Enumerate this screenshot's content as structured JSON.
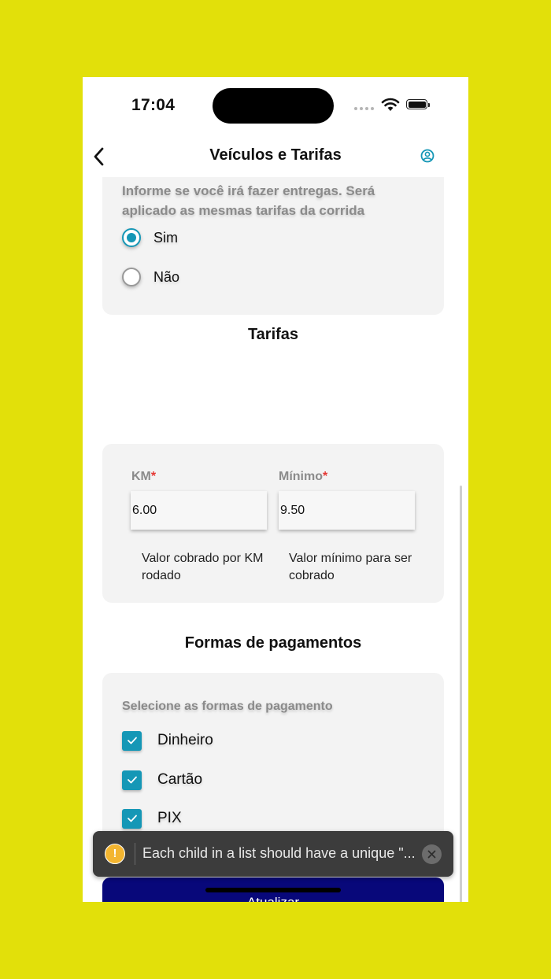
{
  "status_bar": {
    "time": "17:04"
  },
  "header": {
    "title": "Veículos e Tarifas",
    "back_icon": "chevron-left-icon",
    "profile_icon": "user-circle-icon",
    "accent_color": "#1597b6"
  },
  "delivery": {
    "hint": "Informe se você irá fazer entregas. Será aplicado as mesmas tarifas da corrida",
    "options": [
      {
        "label": "Sim",
        "selected": true
      },
      {
        "label": "Não",
        "selected": false
      }
    ]
  },
  "tarifas": {
    "title": "Tarifas",
    "km": {
      "label": "KM",
      "required_mark": "*",
      "value": "6.00",
      "help": "Valor cobrado por KM rodado"
    },
    "minimo": {
      "label": "Mínimo",
      "required_mark": "*",
      "value": "9.50",
      "help": "Valor mínimo para ser cobrado"
    }
  },
  "payment": {
    "title": "Formas de pagamentos",
    "hint": "Selecione as formas de pagamento",
    "options": [
      {
        "label": "Dinheiro",
        "checked": true
      },
      {
        "label": "Cartão",
        "checked": true
      },
      {
        "label": "PIX",
        "checked": true
      }
    ]
  },
  "update_button": {
    "label": "Atualizar",
    "color": "#08087a"
  },
  "toast": {
    "icon": "warning-icon",
    "message": "Each child in a list should have a unique \"...",
    "close_icon": "close-icon"
  },
  "colors": {
    "background": "#e2e00a",
    "card": "#f3f3f3",
    "required": "#e53935"
  }
}
